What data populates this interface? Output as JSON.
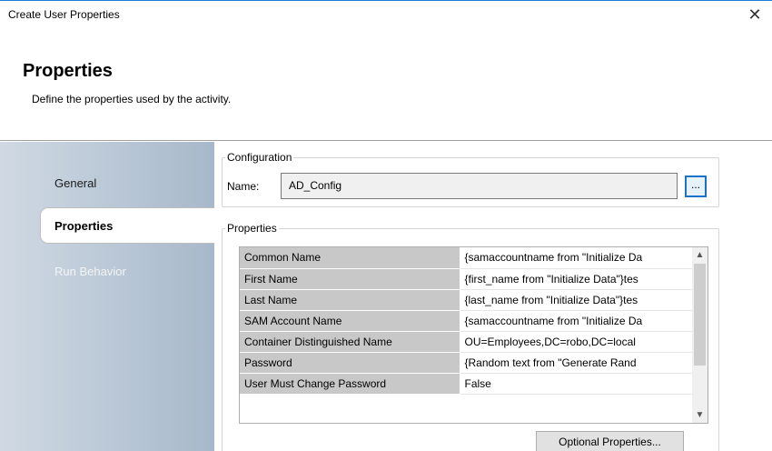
{
  "window": {
    "title": "Create User Properties",
    "close_glyph": "✕"
  },
  "header": {
    "title": "Properties",
    "description": "Define the properties used by the activity."
  },
  "sidebar": {
    "items": [
      {
        "label": "General",
        "state": "normal"
      },
      {
        "label": "Properties",
        "state": "selected"
      },
      {
        "label": "Run Behavior",
        "state": "normal"
      }
    ]
  },
  "configuration": {
    "legend": "Configuration",
    "name_label": "Name:",
    "name_value": "AD_Config",
    "browse_label": "..."
  },
  "properties": {
    "legend": "Properties",
    "rows": [
      {
        "key": "Common Name",
        "value": "{samaccountname from \"Initialize Da"
      },
      {
        "key": "First Name",
        "value": "{first_name from \"Initialize Data\"}tes"
      },
      {
        "key": "Last Name",
        "value": "{last_name from \"Initialize Data\"}tes"
      },
      {
        "key": "SAM Account Name",
        "value": "{samaccountname from \"Initialize Da"
      },
      {
        "key": "Container Distinguished Name",
        "value": "OU=Employees,DC=robo,DC=local"
      },
      {
        "key": "Password",
        "value": "{Random text from \"Generate Rand"
      },
      {
        "key": "User Must Change Password",
        "value": "False"
      }
    ],
    "optional_button": "Optional Properties..."
  },
  "icons": {
    "close": "close-icon",
    "scroll_up": "chevron-up-icon",
    "scroll_down": "chevron-down-icon"
  }
}
